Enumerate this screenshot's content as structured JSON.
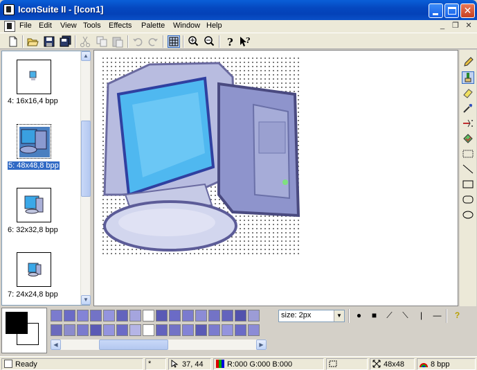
{
  "window": {
    "title": "IconSuite II - [Icon1]",
    "minimize_icon": "minimize-icon",
    "maximize_icon": "maximize-icon",
    "close_glyph": "✕"
  },
  "menu": {
    "items": [
      "File",
      "Edit",
      "View",
      "Tools",
      "Effects",
      "Palette",
      "Window",
      "Help"
    ],
    "mdi_minimize": "_",
    "mdi_restore": "❐",
    "mdi_close": "✕"
  },
  "toolbar": {
    "buttons": [
      "new-icon",
      "open-folder-icon",
      "save-icon",
      "save-all-icon",
      "cut-icon",
      "copy-icon",
      "paste-icon",
      "undo-icon",
      "redo-icon",
      "grid-icon",
      "zoom-in-icon",
      "zoom-out-icon",
      "help-icon",
      "context-help-icon"
    ]
  },
  "thumbnails": [
    {
      "label": "4: 16x16,4 bpp",
      "selected": false
    },
    {
      "label": "5: 48x48,8 bpp",
      "selected": true
    },
    {
      "label": "6: 32x32,8 bpp",
      "selected": false
    },
    {
      "label": "7: 24x24,8 bpp",
      "selected": false
    }
  ],
  "right_tools": [
    "pencil-icon",
    "brush-icon",
    "eraser-icon",
    "eyedropper-icon",
    "spray-icon",
    "fill-icon",
    "select-rect-icon",
    "line-icon",
    "rectangle-icon",
    "rounded-rect-icon",
    "ellipse-icon"
  ],
  "colors": {
    "foreground": "#000000",
    "background": "#ffffff",
    "selection": "#316ac5",
    "palette_row1": [
      "#7b7bce",
      "#6b6bc6",
      "#8484d6",
      "#7373c6",
      "#9494de",
      "#6363bd",
      "#a5a5de",
      "#ffffff",
      "#5a5ab5",
      "#6b6bc6",
      "#7b7bce",
      "#8c8cd6",
      "#7373c6",
      "#6363bd",
      "#5252ad",
      "#9c9cd6"
    ],
    "palette_row2": [
      "#6b6bbd",
      "#8c8ccc",
      "#7b7bce",
      "#5a5ab5",
      "#9494de",
      "#6b6bc6",
      "#b5b5e6",
      "#ffffff",
      "#6363bd",
      "#7373c6",
      "#8484d6",
      "#5a5ab5",
      "#7b7bce",
      "#9494de",
      "#6b6bc6",
      "#8c8cd6"
    ]
  },
  "brush": {
    "size_label": "size: 2px",
    "dropdown_arrow": "▼",
    "shapes": [
      "●",
      "■",
      "⟋",
      "⟍",
      "|",
      "—"
    ],
    "help": "?"
  },
  "status": {
    "ready": "Ready",
    "modified": "*",
    "cursor_pos": "37, 44",
    "color_value": "R:000 G:000 B:000",
    "image_size": "48x48",
    "bit_depth": "8 bpp"
  }
}
